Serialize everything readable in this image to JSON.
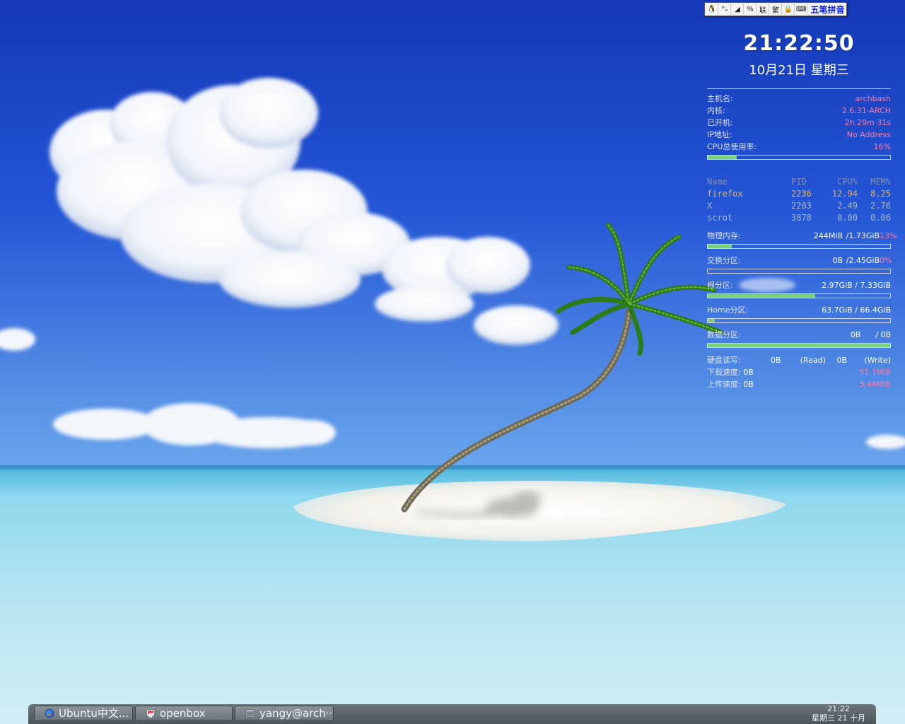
{
  "ime_toolbar": {
    "buttons": [
      "tux-icon",
      "punctuation-icon",
      "skin-icon",
      "mode-icon",
      "联",
      "繁",
      "lock-icon",
      "keyboard-icon"
    ],
    "button_glyphs": [
      "🐧",
      "°ₒ",
      "◢",
      "%",
      "联",
      "繁",
      "🔒",
      "⌨"
    ],
    "mode": "五笔拼音"
  },
  "conky": {
    "time": "21:22:50",
    "date": "10月21日 星期三",
    "system": [
      {
        "label": "主机名:",
        "value": "archbash"
      },
      {
        "label": "内核:",
        "value": "2.6.31-ARCH"
      },
      {
        "label": "已开机:",
        "value": "2h 29m 31s"
      },
      {
        "label": "IP地址:",
        "value": "No Address"
      },
      {
        "label": "CPU总使用率:",
        "value": "16%"
      }
    ],
    "cpu_percent": 16,
    "processes": {
      "header": [
        "Name",
        "PID",
        "CPU%",
        "MEM%"
      ],
      "rows": [
        [
          "firefox",
          "2236",
          "12.94",
          "8.25"
        ],
        [
          "X",
          "2203",
          "2.49",
          "2.76"
        ],
        [
          "scrot",
          "3878",
          "0.00",
          "0.06"
        ]
      ]
    },
    "memory": [
      {
        "label": "物理内存:",
        "used": "244MiB",
        "total": "/1.73GiB",
        "percent_text": "13%",
        "percent": 13
      },
      {
        "label": "交换分区:",
        "used": "0B",
        "total": "/2.45GiB",
        "percent_text": "0%",
        "percent": 0
      }
    ],
    "disks": [
      {
        "label": "根分区:",
        "value": "2.97GiB / 7.33GiB",
        "percent": 59
      },
      {
        "label": "Home分区:",
        "value": "63.7GiB / 66.4GiB",
        "percent": 4
      },
      {
        "label": "数据分区:",
        "value": "0B      / 0B",
        "percent": 100
      }
    ],
    "io": {
      "label": "硬盘读写:",
      "read": "0B",
      "read_label": "(Read)",
      "write": "0B",
      "write_label": "(Write)"
    },
    "network": [
      {
        "label": "下载速度:",
        "now": "0B",
        "total": "51.1MiB"
      },
      {
        "label": "上传速度:",
        "now": "0B",
        "total": "3.44MiB"
      }
    ]
  },
  "taskbar": {
    "tasks": [
      {
        "title": "Ubuntu中文...",
        "icon": "firefox-globe-icon"
      },
      {
        "title": "openbox",
        "icon": "shield-icon"
      },
      {
        "title": "yangy@arch···",
        "icon": "terminal-icon"
      }
    ],
    "clock_time": "21:22",
    "clock_date": "星期三 21 十月"
  },
  "colors": {
    "sky_top": "#1c45c9",
    "sky_bottom": "#6a9fe8",
    "sea": "#7ecfe6",
    "conky_value": "#ff7aa2",
    "conky_bar": "#7dcf80",
    "top_process": "#f0b040",
    "ime_mode": "#0a1adf"
  }
}
